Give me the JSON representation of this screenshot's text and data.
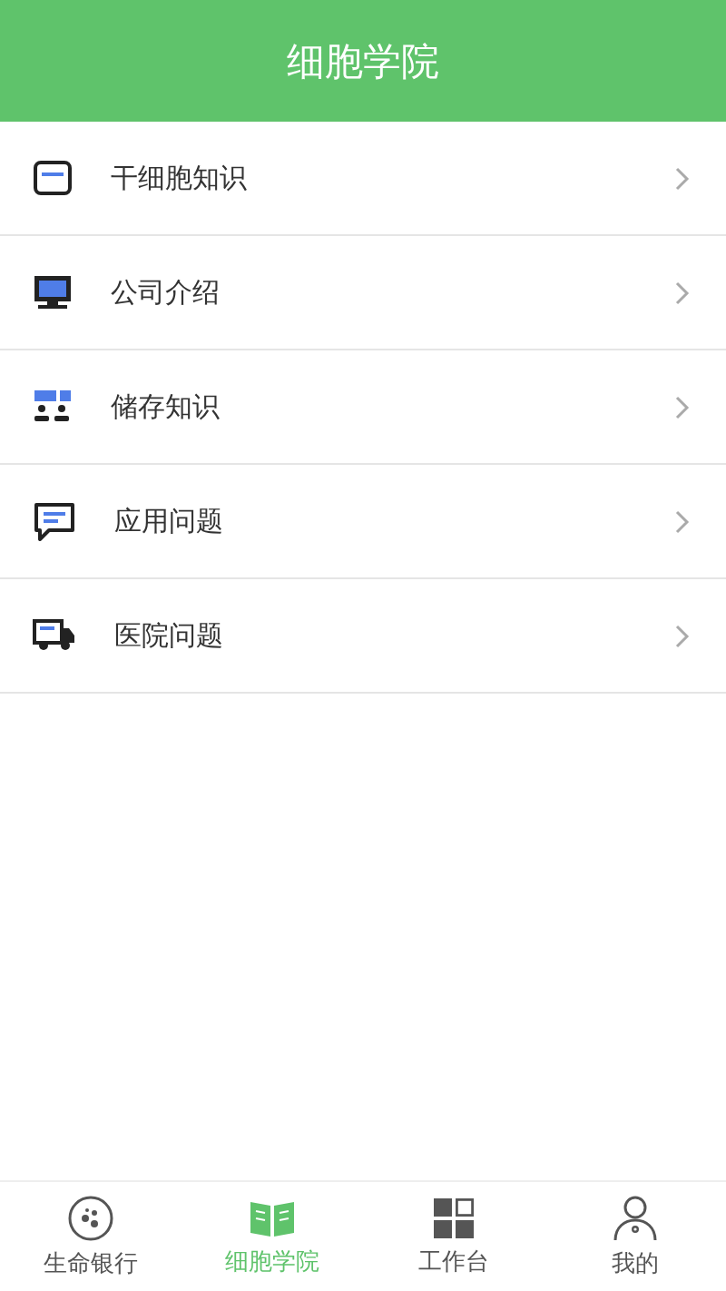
{
  "header": {
    "title": "细胞学院"
  },
  "menu": [
    {
      "kind": "card",
      "label": "干细胞知识"
    },
    {
      "kind": "monitor",
      "label": "公司介绍"
    },
    {
      "kind": "people",
      "label": "储存知识"
    },
    {
      "kind": "chat",
      "label": "应用问题"
    },
    {
      "kind": "truck",
      "label": "医院问题"
    }
  ],
  "tabs": [
    {
      "kind": "cells",
      "label": "生命银行",
      "selected": false
    },
    {
      "kind": "book",
      "label": "细胞学院",
      "selected": true
    },
    {
      "kind": "grid",
      "label": "工作台",
      "selected": false
    },
    {
      "kind": "person",
      "label": "我的",
      "selected": false
    }
  ]
}
